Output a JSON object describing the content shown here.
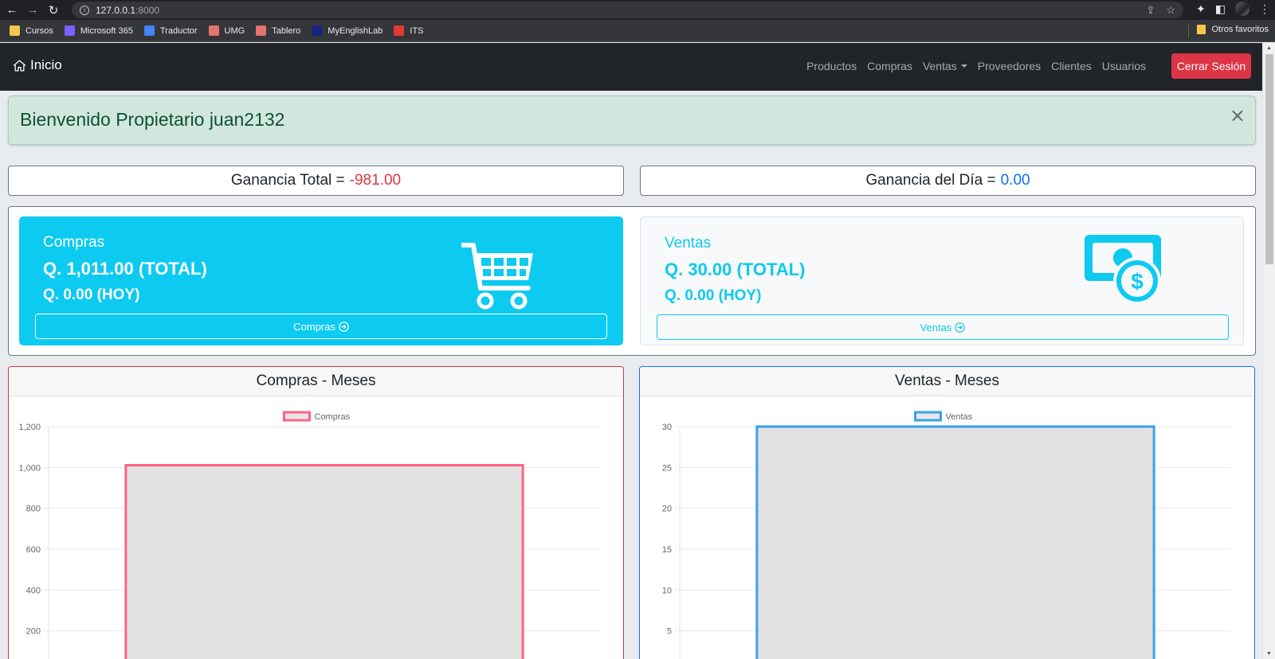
{
  "browser": {
    "url_host": "127.0.0.1",
    "url_port": ":8000",
    "bookmarks": [
      {
        "label": "Cursos",
        "color": "#f2c94c"
      },
      {
        "label": "Microsoft 365",
        "color": "#7b61ff"
      },
      {
        "label": "Traductor",
        "color": "#4285f4"
      },
      {
        "label": "UMG",
        "color": "#e57373"
      },
      {
        "label": "Tablero",
        "color": "#e57373"
      },
      {
        "label": "MyEnglishLab",
        "color": "#1a237e"
      },
      {
        "label": "ITS",
        "color": "#e53935"
      }
    ],
    "other_bookmarks": "Otros favoritos"
  },
  "navbar": {
    "brand": "Inicio",
    "links": [
      "Productos",
      "Compras",
      "Ventas",
      "Proveedores",
      "Clientes",
      "Usuarios"
    ],
    "logout": "Cerrar Sesión"
  },
  "alert": {
    "message": "Bienvenido Propietario juan2132",
    "close": "×"
  },
  "ganancias": {
    "total_label": "Ganancia Total =",
    "total_value": "-981.00",
    "dia_label": "Ganancia del Día =",
    "dia_value": "0.00"
  },
  "compras_card": {
    "title": "Compras",
    "total": "Q. 1,011.00 (TOTAL)",
    "today": "Q. 0.00 (HOY)",
    "button": "Compras",
    "icon": "shopping-cart-icon"
  },
  "ventas_card": {
    "title": "Ventas",
    "total": "Q. 30.00 (TOTAL)",
    "today": "Q. 0.00 (HOY)",
    "button": "Ventas",
    "icon": "money-icon"
  },
  "colors": {
    "info": "#0dcaf0",
    "danger": "#dc3545",
    "primary": "#0d6efd",
    "compras_series": "#ff6384",
    "ventas_series": "#36a2eb"
  },
  "chart_data": [
    {
      "type": "bar",
      "title": "Compras - Meses",
      "series": [
        {
          "name": "Compras",
          "values": [
            1011
          ]
        }
      ],
      "yticks": [
        "200",
        "400",
        "600",
        "800",
        "1,000",
        "1,200"
      ],
      "ylim": [
        0,
        1200
      ],
      "legend": "top-center",
      "grid": true
    },
    {
      "type": "bar",
      "title": "Ventas - Meses",
      "series": [
        {
          "name": "Ventas",
          "values": [
            30
          ]
        }
      ],
      "yticks": [
        "5",
        "10",
        "15",
        "20",
        "25",
        "30"
      ],
      "ylim": [
        0,
        30
      ],
      "legend": "top-center",
      "grid": true
    }
  ]
}
